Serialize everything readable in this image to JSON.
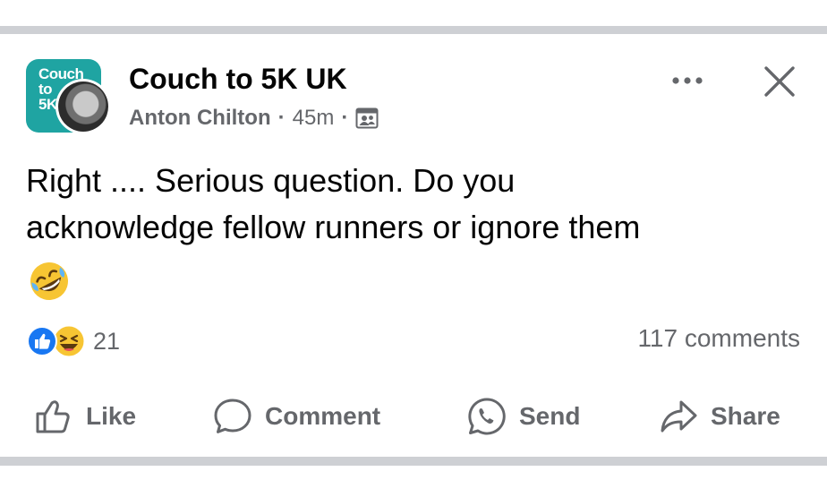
{
  "post": {
    "group_name": "Couch to 5K UK",
    "group_logo_text": "Couch\nto\n5K",
    "author": "Anton Chilton",
    "separator": "·",
    "time": "45m",
    "audience_icon": "members-icon",
    "text": "Right .... Serious question. Do you\nacknowledge fellow runners or ignore them",
    "emoji": "rolling-on-floor-laughing-emoji"
  },
  "reactions": {
    "types": [
      "like",
      "haha"
    ],
    "count": "21"
  },
  "comments": {
    "count_label": "117 comments"
  },
  "actions": {
    "like": "Like",
    "comment": "Comment",
    "send": "Send",
    "share": "Share"
  },
  "colors": {
    "text": "#050505",
    "secondary": "#65676b",
    "divider": "#ced0d4",
    "group_logo_bg": "#1fa4a2",
    "like_blue": "#1877f2"
  }
}
